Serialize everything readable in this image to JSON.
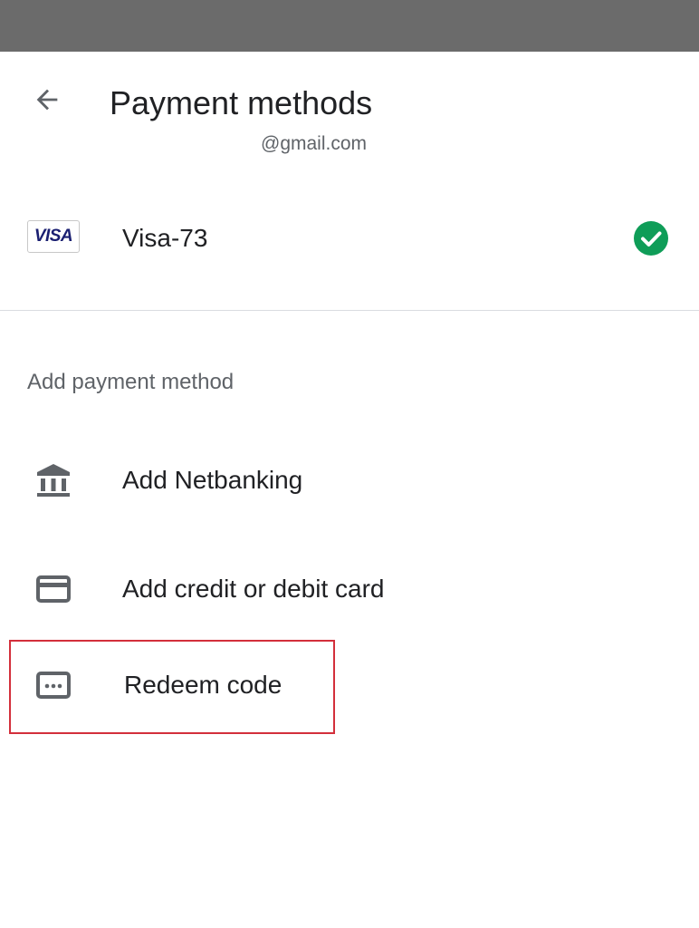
{
  "status_bar": {},
  "header": {
    "title": "Payment methods",
    "account_email": "@gmail.com",
    "back_icon": "arrow-back-icon"
  },
  "saved_methods": [
    {
      "logo_text": "VISA",
      "label": "Visa-73",
      "selected": true,
      "status_icon": "check-circle-icon",
      "status_color": "#0f9d58"
    }
  ],
  "add_section": {
    "heading": "Add payment method",
    "options": [
      {
        "label": "Add Netbanking",
        "icon": "bank-icon"
      },
      {
        "label": "Add credit or debit card",
        "icon": "credit-card-icon"
      },
      {
        "label": "Redeem code",
        "icon": "redeem-code-icon",
        "highlighted": true
      }
    ]
  },
  "colors": {
    "status_bar": "#6b6b6b",
    "primary_text": "#202124",
    "secondary_text": "#5f6368",
    "icon": "#5f6368",
    "visa_blue": "#1a1f71",
    "check_green": "#0f9d58",
    "highlight_red": "#d32f3b",
    "divider": "#dadce0"
  }
}
